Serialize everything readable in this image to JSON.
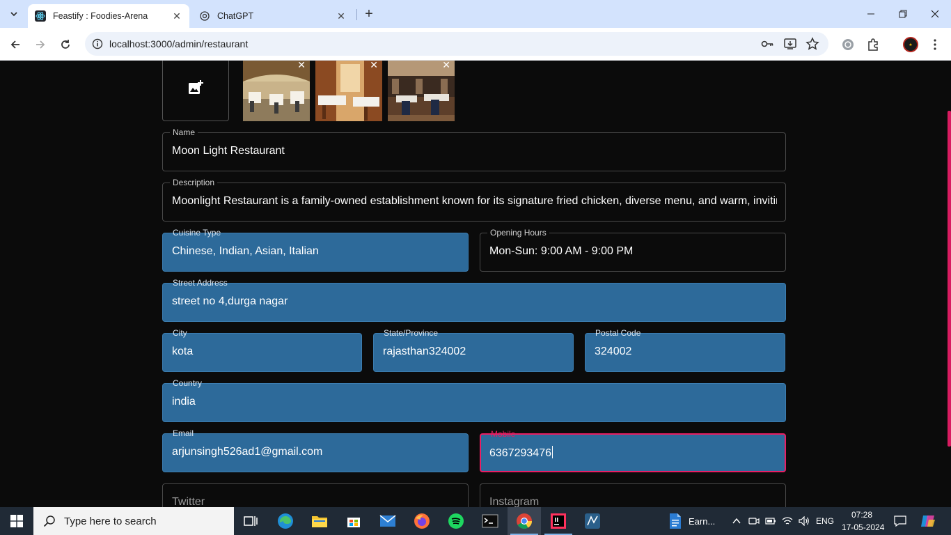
{
  "browser": {
    "tabs": [
      {
        "title": "Feastify : Foodies-Arena",
        "active": true
      },
      {
        "title": "ChatGPT",
        "active": false
      }
    ],
    "url": "localhost:3000/admin/restaurant"
  },
  "form": {
    "name": {
      "label": "Name",
      "value": "Moon Light Restaurant"
    },
    "description": {
      "label": "Description",
      "value": "Moonlight Restaurant is a family-owned establishment known for its signature fried chicken, diverse menu, and warm, inviting atmosphere."
    },
    "cuisine": {
      "label": "Cuisine Type",
      "value": "Chinese, Indian, Asian, Italian"
    },
    "hours": {
      "label": "Opening Hours",
      "value": "Mon-Sun: 9:00 AM - 9:00 PM"
    },
    "street": {
      "label": "Street Address",
      "value": "street no 4,durga nagar"
    },
    "city": {
      "label": "City",
      "value": "kota"
    },
    "state": {
      "label": "State/Province",
      "value": "rajasthan324002"
    },
    "postal": {
      "label": "Postal Code",
      "value": "324002"
    },
    "country": {
      "label": "Country",
      "value": "india"
    },
    "email": {
      "label": "Email",
      "value": "arjunsingh526ad1@gmail.com"
    },
    "mobile": {
      "label": "Mobile",
      "value": "6367293476"
    },
    "twitter": {
      "placeholder": "Twitter"
    },
    "instagram": {
      "placeholder": "Instagram"
    }
  },
  "taskbar": {
    "search_placeholder": "Type here to search",
    "earnings_label": "Earn...",
    "language": "ENG",
    "time": "07:28",
    "date": "17-05-2024"
  },
  "colors": {
    "field_fill": "#2d6a9a",
    "focus_accent": "#e91e63",
    "page_bg": "#0b0b0b"
  }
}
